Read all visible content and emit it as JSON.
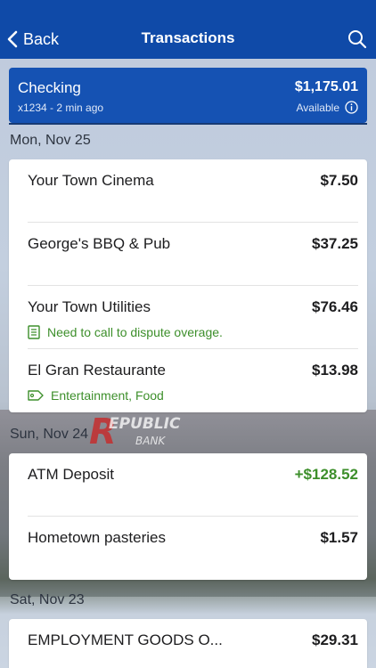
{
  "nav": {
    "back_label": "Back",
    "title": "Transactions"
  },
  "account": {
    "name": "Checking",
    "sub": "x1234 - 2 min ago",
    "balance": "$1,175.01",
    "available_label": "Available"
  },
  "background": {
    "sign_letter": "R",
    "sign_line1": "EPUBLIC",
    "sign_line2": "BANK"
  },
  "groups": [
    {
      "date": "Mon, Nov 25",
      "transactions": [
        {
          "title": "Your Town Cinema",
          "amount": "$7.50"
        },
        {
          "title": "George's BBQ & Pub",
          "amount": "$37.25"
        },
        {
          "title": "Your Town Utilities",
          "amount": "$76.46",
          "note": "Need to call to dispute overage.",
          "note_icon": "note-icon"
        },
        {
          "title": "El Gran Restaurante",
          "amount": "$13.98",
          "note": "Entertainment, Food",
          "note_icon": "tag-icon"
        }
      ]
    },
    {
      "date": "Sun, Nov 24",
      "transactions": [
        {
          "title": "ATM Deposit",
          "amount": "+$128.52",
          "positive": true
        },
        {
          "title": "Hometown pasteries",
          "amount": "$1.57"
        }
      ]
    },
    {
      "date": "Sat, Nov 23",
      "transactions": [
        {
          "title": "EMPLOYMENT GOODS O...",
          "amount": "$29.31"
        }
      ]
    }
  ],
  "colors": {
    "nav_bg": "#0f4aa8",
    "account_bg": "#1552b3",
    "positive": "#3d8f2b"
  }
}
